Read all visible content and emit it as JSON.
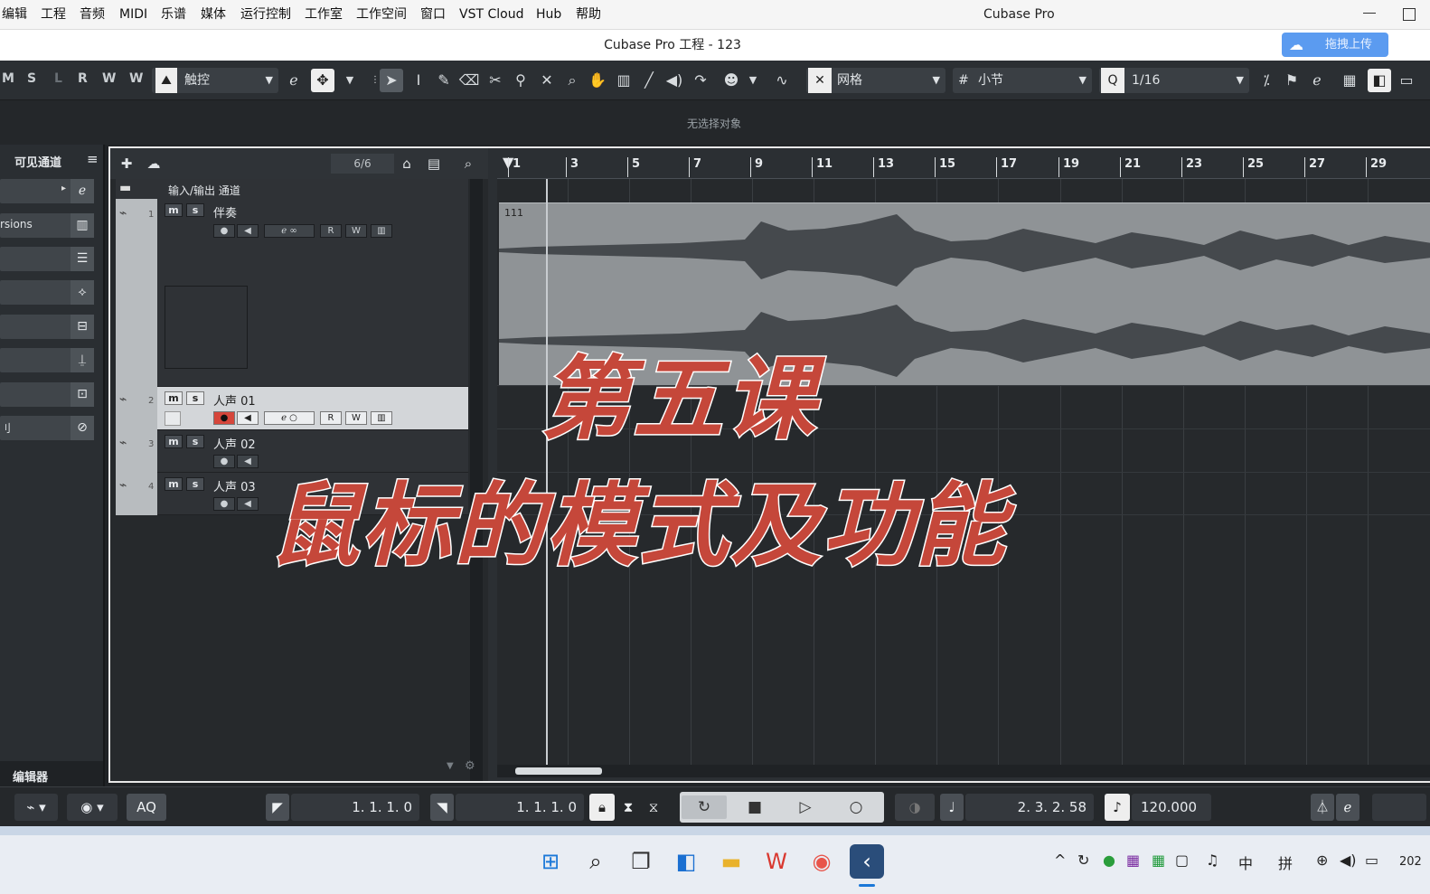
{
  "menu": [
    "编辑",
    "工程",
    "音频",
    "MIDI",
    "乐谱",
    "媒体",
    "运行控制",
    "工作室",
    "工作空间",
    "窗口",
    "VST Cloud",
    "Hub",
    "帮助"
  ],
  "app_title": "Cubase Pro",
  "project_title": "Cubase Pro 工程 - 123",
  "upload_label": "拖拽上传",
  "toolbar": {
    "letters": [
      "M",
      "S",
      "L",
      "R",
      "W",
      "A"
    ],
    "touch_mode": "触控",
    "grid_type": "网格",
    "grid_unit": "小节",
    "quantize": "1/16"
  },
  "info_line": "无选择对象",
  "left_zone": {
    "title": "可见通道",
    "rows": [
      "",
      "rsions",
      "",
      "",
      "",
      "",
      "",
      "刂"
    ],
    "editor_label": "编辑器"
  },
  "track_count": "6/6",
  "folder_track": "输入/输出 通道",
  "tracks": [
    {
      "num": "1",
      "name": "伴奏",
      "selected": false,
      "record": false
    },
    {
      "num": "2",
      "name": "人声 01",
      "selected": true,
      "record": true
    },
    {
      "num": "3",
      "name": "人声 02",
      "selected": false,
      "record": false
    },
    {
      "num": "4",
      "name": "人声 03",
      "selected": false,
      "record": false
    }
  ],
  "ruler_bars": [
    "1",
    "3",
    "5",
    "7",
    "9",
    "11",
    "13",
    "15",
    "17",
    "19",
    "21",
    "23",
    "25",
    "27",
    "29"
  ],
  "event_label": "111",
  "overlay": {
    "line1": "第五课",
    "line2": "鼠标的模式及功能"
  },
  "transport": {
    "left_locator": "1. 1. 1.   0",
    "right_locator": "1. 1. 1.   0",
    "position": "2. 3. 2. 58",
    "tempo": "120.000",
    "aq_label": "AQ"
  },
  "taskbar": {
    "ime_lang": "中",
    "ime_mode": "拼",
    "clock_fragment": "202"
  }
}
